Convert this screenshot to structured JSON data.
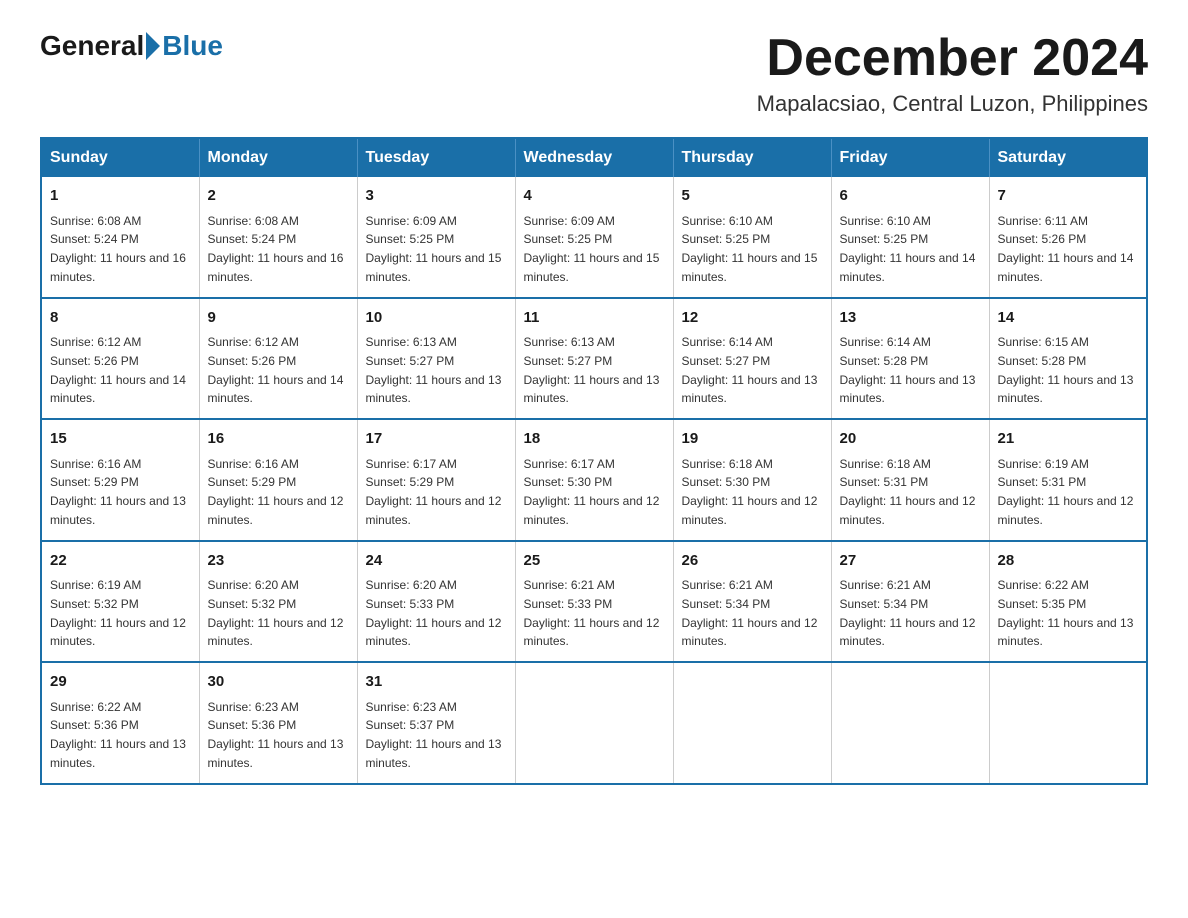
{
  "header": {
    "logo_general": "General",
    "logo_blue": "Blue",
    "month_title": "December 2024",
    "location": "Mapalacsiao, Central Luzon, Philippines"
  },
  "weekdays": [
    "Sunday",
    "Monday",
    "Tuesday",
    "Wednesday",
    "Thursday",
    "Friday",
    "Saturday"
  ],
  "weeks": [
    [
      {
        "day": "1",
        "sunrise": "6:08 AM",
        "sunset": "5:24 PM",
        "daylight": "11 hours and 16 minutes."
      },
      {
        "day": "2",
        "sunrise": "6:08 AM",
        "sunset": "5:24 PM",
        "daylight": "11 hours and 16 minutes."
      },
      {
        "day": "3",
        "sunrise": "6:09 AM",
        "sunset": "5:25 PM",
        "daylight": "11 hours and 15 minutes."
      },
      {
        "day": "4",
        "sunrise": "6:09 AM",
        "sunset": "5:25 PM",
        "daylight": "11 hours and 15 minutes."
      },
      {
        "day": "5",
        "sunrise": "6:10 AM",
        "sunset": "5:25 PM",
        "daylight": "11 hours and 15 minutes."
      },
      {
        "day": "6",
        "sunrise": "6:10 AM",
        "sunset": "5:25 PM",
        "daylight": "11 hours and 14 minutes."
      },
      {
        "day": "7",
        "sunrise": "6:11 AM",
        "sunset": "5:26 PM",
        "daylight": "11 hours and 14 minutes."
      }
    ],
    [
      {
        "day": "8",
        "sunrise": "6:12 AM",
        "sunset": "5:26 PM",
        "daylight": "11 hours and 14 minutes."
      },
      {
        "day": "9",
        "sunrise": "6:12 AM",
        "sunset": "5:26 PM",
        "daylight": "11 hours and 14 minutes."
      },
      {
        "day": "10",
        "sunrise": "6:13 AM",
        "sunset": "5:27 PM",
        "daylight": "11 hours and 13 minutes."
      },
      {
        "day": "11",
        "sunrise": "6:13 AM",
        "sunset": "5:27 PM",
        "daylight": "11 hours and 13 minutes."
      },
      {
        "day": "12",
        "sunrise": "6:14 AM",
        "sunset": "5:27 PM",
        "daylight": "11 hours and 13 minutes."
      },
      {
        "day": "13",
        "sunrise": "6:14 AM",
        "sunset": "5:28 PM",
        "daylight": "11 hours and 13 minutes."
      },
      {
        "day": "14",
        "sunrise": "6:15 AM",
        "sunset": "5:28 PM",
        "daylight": "11 hours and 13 minutes."
      }
    ],
    [
      {
        "day": "15",
        "sunrise": "6:16 AM",
        "sunset": "5:29 PM",
        "daylight": "11 hours and 13 minutes."
      },
      {
        "day": "16",
        "sunrise": "6:16 AM",
        "sunset": "5:29 PM",
        "daylight": "11 hours and 12 minutes."
      },
      {
        "day": "17",
        "sunrise": "6:17 AM",
        "sunset": "5:29 PM",
        "daylight": "11 hours and 12 minutes."
      },
      {
        "day": "18",
        "sunrise": "6:17 AM",
        "sunset": "5:30 PM",
        "daylight": "11 hours and 12 minutes."
      },
      {
        "day": "19",
        "sunrise": "6:18 AM",
        "sunset": "5:30 PM",
        "daylight": "11 hours and 12 minutes."
      },
      {
        "day": "20",
        "sunrise": "6:18 AM",
        "sunset": "5:31 PM",
        "daylight": "11 hours and 12 minutes."
      },
      {
        "day": "21",
        "sunrise": "6:19 AM",
        "sunset": "5:31 PM",
        "daylight": "11 hours and 12 minutes."
      }
    ],
    [
      {
        "day": "22",
        "sunrise": "6:19 AM",
        "sunset": "5:32 PM",
        "daylight": "11 hours and 12 minutes."
      },
      {
        "day": "23",
        "sunrise": "6:20 AM",
        "sunset": "5:32 PM",
        "daylight": "11 hours and 12 minutes."
      },
      {
        "day": "24",
        "sunrise": "6:20 AM",
        "sunset": "5:33 PM",
        "daylight": "11 hours and 12 minutes."
      },
      {
        "day": "25",
        "sunrise": "6:21 AM",
        "sunset": "5:33 PM",
        "daylight": "11 hours and 12 minutes."
      },
      {
        "day": "26",
        "sunrise": "6:21 AM",
        "sunset": "5:34 PM",
        "daylight": "11 hours and 12 minutes."
      },
      {
        "day": "27",
        "sunrise": "6:21 AM",
        "sunset": "5:34 PM",
        "daylight": "11 hours and 12 minutes."
      },
      {
        "day": "28",
        "sunrise": "6:22 AM",
        "sunset": "5:35 PM",
        "daylight": "11 hours and 13 minutes."
      }
    ],
    [
      {
        "day": "29",
        "sunrise": "6:22 AM",
        "sunset": "5:36 PM",
        "daylight": "11 hours and 13 minutes."
      },
      {
        "day": "30",
        "sunrise": "6:23 AM",
        "sunset": "5:36 PM",
        "daylight": "11 hours and 13 minutes."
      },
      {
        "day": "31",
        "sunrise": "6:23 AM",
        "sunset": "5:37 PM",
        "daylight": "11 hours and 13 minutes."
      },
      null,
      null,
      null,
      null
    ]
  ]
}
